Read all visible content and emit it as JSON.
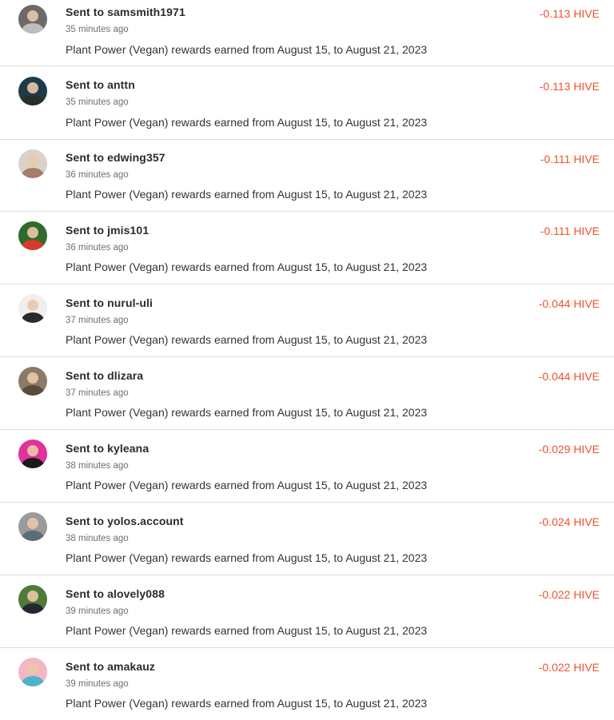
{
  "colors": {
    "amount": "#f0532d",
    "divider": "#dcdcdc",
    "title": "#2b2b2b",
    "time": "#6f6f6f"
  },
  "transactions": [
    {
      "title": "Sent to samsmith1971",
      "time": "35 minutes ago",
      "memo": "Plant Power (Vegan) rewards earned from August 15, to August 21, 2023",
      "amount": "-0.113 HIVE",
      "avatar_colors": [
        "#6b6b6b",
        "#bdbdbd"
      ]
    },
    {
      "title": "Sent to anttn",
      "time": "35 minutes ago",
      "memo": "Plant Power (Vegan) rewards earned from August 15, to August 21, 2023",
      "amount": "-0.113 HIVE",
      "avatar_colors": [
        "#1f3b4a",
        "#2c2c2c"
      ]
    },
    {
      "title": "Sent to edwing357",
      "time": "36 minutes ago",
      "memo": "Plant Power (Vegan) rewards earned from August 15, to August 21, 2023",
      "amount": "-0.111 HIVE",
      "avatar_colors": [
        "#d9d2cc",
        "#a77d6a"
      ]
    },
    {
      "title": "Sent to jmis101",
      "time": "36 minutes ago",
      "memo": "Plant Power (Vegan) rewards earned from August 15, to August 21, 2023",
      "amount": "-0.111 HIVE",
      "avatar_colors": [
        "#2f6b2a",
        "#d63a2a"
      ]
    },
    {
      "title": "Sent to nurul-uli",
      "time": "37 minutes ago",
      "memo": "Plant Power (Vegan) rewards earned from August 15, to August 21, 2023",
      "amount": "-0.044 HIVE",
      "avatar_colors": [
        "#efefef",
        "#2a2a2a"
      ]
    },
    {
      "title": "Sent to dlizara",
      "time": "37 minutes ago",
      "memo": "Plant Power (Vegan) rewards earned from August 15, to August 21, 2023",
      "amount": "-0.044 HIVE",
      "avatar_colors": [
        "#8a7a66",
        "#5a4a3a"
      ]
    },
    {
      "title": "Sent to kyleana",
      "time": "38 minutes ago",
      "memo": "Plant Power (Vegan) rewards earned from August 15, to August 21, 2023",
      "amount": "-0.029 HIVE",
      "avatar_colors": [
        "#e0329a",
        "#1a1a1a"
      ]
    },
    {
      "title": "Sent to yolos.account",
      "time": "38 minutes ago",
      "memo": "Plant Power (Vegan) rewards earned from August 15, to August 21, 2023",
      "amount": "-0.024 HIVE",
      "avatar_colors": [
        "#9a9a9a",
        "#5d6b74"
      ]
    },
    {
      "title": "Sent to alovely088",
      "time": "39 minutes ago",
      "memo": "Plant Power (Vegan) rewards earned from August 15, to August 21, 2023",
      "amount": "-0.022 HIVE",
      "avatar_colors": [
        "#4f7a3a",
        "#222833"
      ]
    },
    {
      "title": "Sent to amakauz",
      "time": "39 minutes ago",
      "memo": "Plant Power (Vegan) rewards earned from August 15, to August 21, 2023",
      "amount": "-0.022 HIVE",
      "avatar_colors": [
        "#f2b6c4",
        "#4fb3c6"
      ]
    }
  ]
}
